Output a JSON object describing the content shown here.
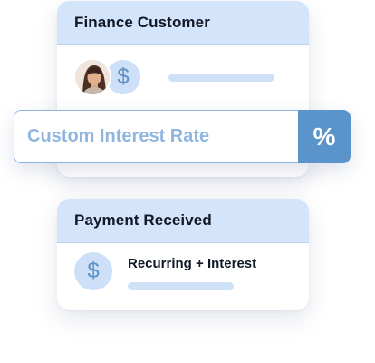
{
  "finance_card": {
    "title": "Finance Customer",
    "currency_icon": "$"
  },
  "interest_field": {
    "placeholder": "Custom Interest Rate",
    "unit_symbol": "%"
  },
  "payment_card": {
    "title": "Payment Received",
    "label": "Recurring + Interest",
    "currency_icon": "$"
  },
  "colors": {
    "header_bg": "#d3e4fb",
    "accent": "#5b93cb",
    "placeholder_text": "#90b6df",
    "bar": "#cfe1f7"
  },
  "icons": {
    "avatar": "customer-avatar",
    "dollar": "dollar-icon",
    "percent": "percent-icon"
  }
}
